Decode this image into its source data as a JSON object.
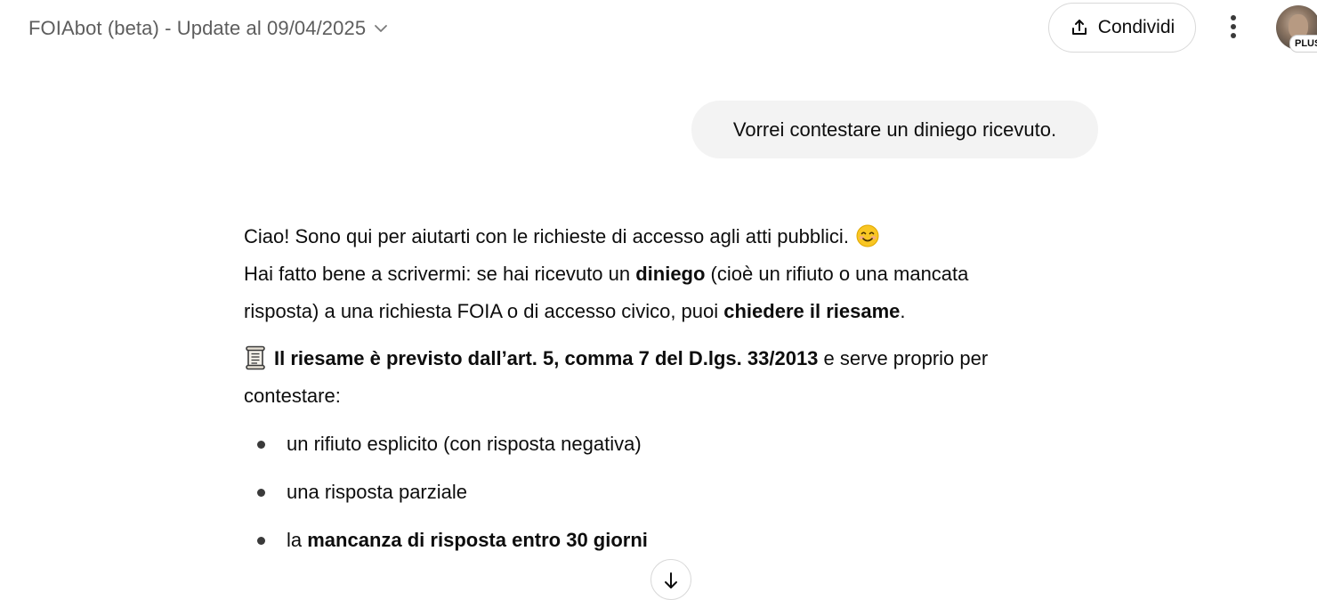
{
  "header": {
    "model_title": "FOIAbot (beta) - Update al 09/04/2025",
    "share_label": "Condividi",
    "plan_badge": "PLUS",
    "icons": {
      "chevron": "chevron-down-icon",
      "share": "share-upload-icon",
      "menu": "more-vertical-icon"
    }
  },
  "conversation": {
    "user_message": "Vorrei contestare un diniego ricevuto.",
    "assistant": {
      "line1": "Ciao! Sono qui per aiutarti con le richieste di accesso agli atti pubblici.",
      "line1_emoji": "smiling-face-emoji",
      "line2_a": "Hai fatto bene a scrivermi: se hai ricevuto un ",
      "line2_bold1": "diniego",
      "line2_b": " (cioè un rifiuto o una mancata risposta) a una richiesta FOIA o di accesso civico, puoi ",
      "line2_bold2": "chiedere il riesame",
      "line2_c": ".",
      "para2_emoji": "scroll-emoji",
      "para2_bold": "Il riesame è previsto dall’art. 5, comma 7 del D.lgs. 33/2013",
      "para2_rest": " e serve proprio per contestare:",
      "bullets": [
        {
          "text": "un rifiuto esplicito (con risposta negativa)",
          "bold": ""
        },
        {
          "text": "una risposta parziale",
          "bold": ""
        },
        {
          "text": "la ",
          "bold": "mancanza di risposta entro 30 giorni"
        }
      ]
    }
  },
  "scroll_button_icon": "arrow-down-icon"
}
